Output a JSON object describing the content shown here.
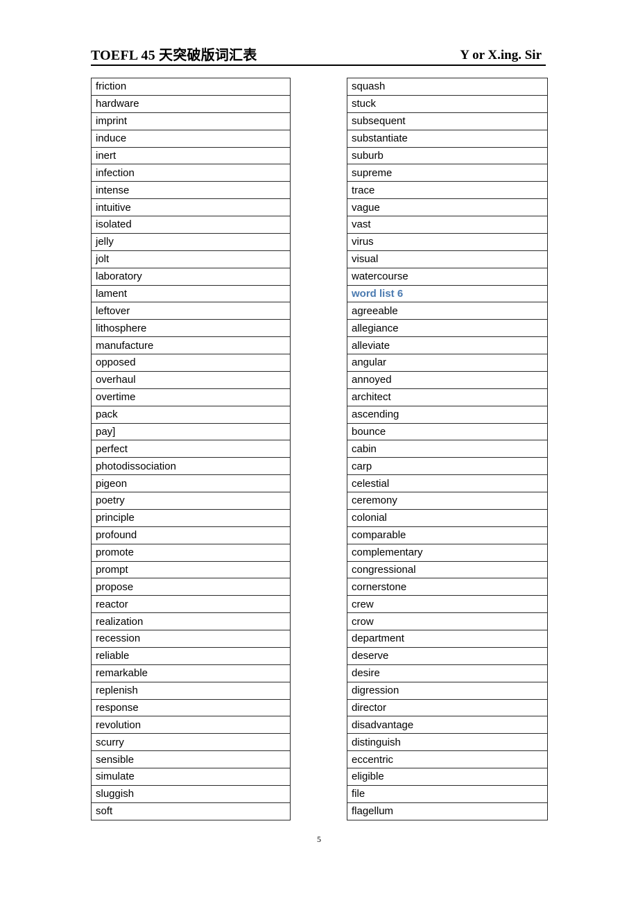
{
  "header": {
    "title": "TOEFL 45 天突破版词汇表",
    "author": "Y or X.ing. Sir"
  },
  "footer": {
    "page_number": "5"
  },
  "colors": {
    "section_heading": "#4a7ab0",
    "text": "#000000",
    "border": "#2b2b2b"
  },
  "columns": {
    "left": [
      {
        "term": "friction",
        "type": "word"
      },
      {
        "term": "hardware",
        "type": "word"
      },
      {
        "term": "imprint",
        "type": "word"
      },
      {
        "term": "induce",
        "type": "word"
      },
      {
        "term": "inert",
        "type": "word"
      },
      {
        "term": "infection",
        "type": "word"
      },
      {
        "term": "intense",
        "type": "word"
      },
      {
        "term": "intuitive",
        "type": "word"
      },
      {
        "term": "isolated",
        "type": "word"
      },
      {
        "term": "jelly",
        "type": "word"
      },
      {
        "term": "jolt",
        "type": "word"
      },
      {
        "term": "laboratory",
        "type": "word"
      },
      {
        "term": "lament",
        "type": "word"
      },
      {
        "term": "leftover",
        "type": "word"
      },
      {
        "term": "lithosphere",
        "type": "word"
      },
      {
        "term": "manufacture",
        "type": "word"
      },
      {
        "term": "opposed",
        "type": "word"
      },
      {
        "term": "overhaul",
        "type": "word"
      },
      {
        "term": "overtime",
        "type": "word"
      },
      {
        "term": "pack",
        "type": "word"
      },
      {
        "term": "pay]",
        "type": "word"
      },
      {
        "term": "perfect",
        "type": "word"
      },
      {
        "term": "photodissociation",
        "type": "word"
      },
      {
        "term": "pigeon",
        "type": "word"
      },
      {
        "term": "poetry",
        "type": "word"
      },
      {
        "term": "principle",
        "type": "word"
      },
      {
        "term": "profound",
        "type": "word"
      },
      {
        "term": "promote",
        "type": "word"
      },
      {
        "term": "prompt",
        "type": "word"
      },
      {
        "term": "propose",
        "type": "word"
      },
      {
        "term": "reactor",
        "type": "word"
      },
      {
        "term": "realization",
        "type": "word"
      },
      {
        "term": "recession",
        "type": "word"
      },
      {
        "term": "reliable",
        "type": "word"
      },
      {
        "term": "remarkable",
        "type": "word"
      },
      {
        "term": "replenish",
        "type": "word"
      },
      {
        "term": "response",
        "type": "word"
      },
      {
        "term": "revolution",
        "type": "word"
      },
      {
        "term": "scurry",
        "type": "word"
      },
      {
        "term": "sensible",
        "type": "word"
      },
      {
        "term": "simulate",
        "type": "word"
      },
      {
        "term": "sluggish",
        "type": "word"
      },
      {
        "term": "soft",
        "type": "word"
      }
    ],
    "right": [
      {
        "term": "squash",
        "type": "word"
      },
      {
        "term": "stuck",
        "type": "word"
      },
      {
        "term": "subsequent",
        "type": "word"
      },
      {
        "term": "substantiate",
        "type": "word"
      },
      {
        "term": "suburb",
        "type": "word"
      },
      {
        "term": "supreme",
        "type": "word"
      },
      {
        "term": "trace",
        "type": "word"
      },
      {
        "term": "vague",
        "type": "word"
      },
      {
        "term": "vast",
        "type": "word"
      },
      {
        "term": "virus",
        "type": "word"
      },
      {
        "term": "visual",
        "type": "word"
      },
      {
        "term": "watercourse",
        "type": "word"
      },
      {
        "term": "word list 6",
        "type": "section"
      },
      {
        "term": "agreeable",
        "type": "word"
      },
      {
        "term": "allegiance",
        "type": "word"
      },
      {
        "term": "alleviate",
        "type": "word"
      },
      {
        "term": "angular",
        "type": "word"
      },
      {
        "term": "annoyed",
        "type": "word"
      },
      {
        "term": "architect",
        "type": "word"
      },
      {
        "term": "ascending",
        "type": "word"
      },
      {
        "term": "bounce",
        "type": "word"
      },
      {
        "term": "cabin",
        "type": "word"
      },
      {
        "term": "carp",
        "type": "word"
      },
      {
        "term": "celestial",
        "type": "word"
      },
      {
        "term": "ceremony",
        "type": "word"
      },
      {
        "term": "colonial",
        "type": "word"
      },
      {
        "term": "comparable",
        "type": "word"
      },
      {
        "term": "complementary",
        "type": "word"
      },
      {
        "term": "congressional",
        "type": "word"
      },
      {
        "term": "cornerstone",
        "type": "word"
      },
      {
        "term": "crew",
        "type": "word"
      },
      {
        "term": "crow",
        "type": "word"
      },
      {
        "term": "department",
        "type": "word"
      },
      {
        "term": "deserve",
        "type": "word"
      },
      {
        "term": "desire",
        "type": "word"
      },
      {
        "term": "digression",
        "type": "word"
      },
      {
        "term": "director",
        "type": "word"
      },
      {
        "term": "disadvantage",
        "type": "word"
      },
      {
        "term": "distinguish",
        "type": "word"
      },
      {
        "term": "eccentric",
        "type": "word"
      },
      {
        "term": "eligible",
        "type": "word"
      },
      {
        "term": "file",
        "type": "word"
      },
      {
        "term": "flagellum",
        "type": "word"
      }
    ]
  }
}
